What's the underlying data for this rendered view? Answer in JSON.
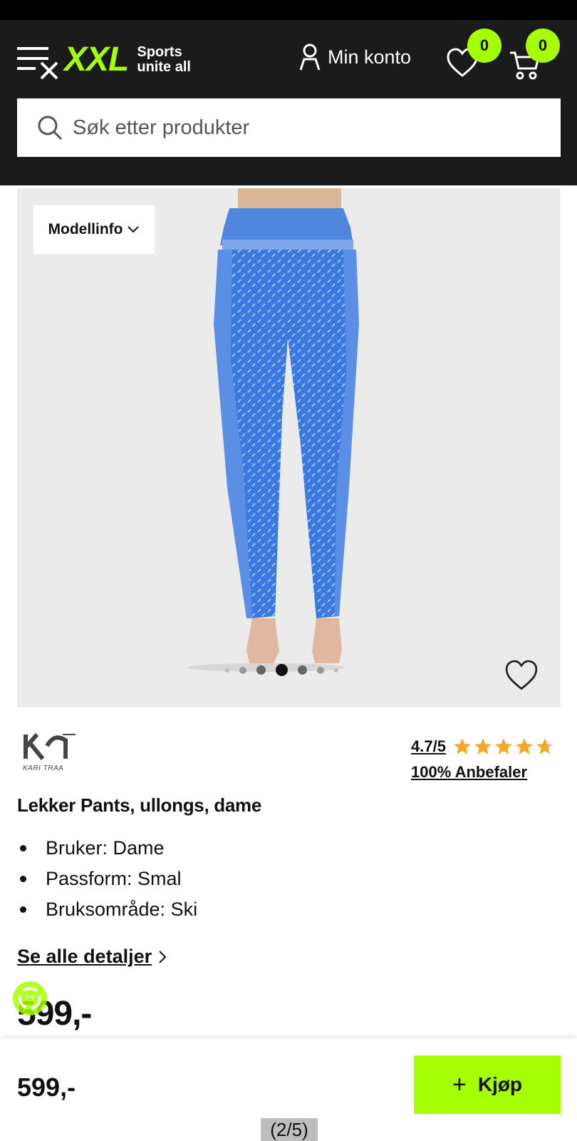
{
  "header": {
    "logo_text": "XXL",
    "tagline_line1": "Sports",
    "tagline_line2": "unite all",
    "account_label": "Min konto",
    "wishlist_count": "0",
    "cart_count": "0"
  },
  "search": {
    "placeholder": "Søk etter produkter"
  },
  "gallery": {
    "model_info_label": "Modellinfo",
    "image_alt": "Blue patterned wool leggings",
    "current_index": 4,
    "total": 7
  },
  "product": {
    "brand": "KARI TRAA",
    "rating": "4.7/5",
    "stars_value": 4.7,
    "recommend": "100% Anbefaler",
    "title": "Lekker Pants, ullongs, dame",
    "features": [
      "Bruker: Dame",
      "Passform: Smal",
      "Bruksområde: Ski"
    ],
    "details_link": "Se alle detaljer",
    "price": "599,-"
  },
  "bottom_bar": {
    "price": "599,-",
    "buy_label": "Kjøp",
    "pager": "(2/5)"
  },
  "colors": {
    "accent": "#a6ff00",
    "header_bg": "#1b1b1b",
    "star": "#f5a623"
  }
}
